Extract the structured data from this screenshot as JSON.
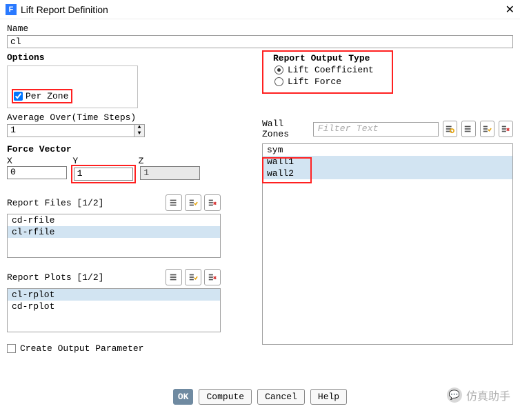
{
  "window": {
    "icon_letter": "F",
    "title": "Lift Report Definition"
  },
  "name_section": {
    "label": "Name",
    "value": "cl"
  },
  "options": {
    "label": "Options",
    "per_zone_label": "Per Zone",
    "per_zone_checked": true
  },
  "avg": {
    "label": "Average Over(Time Steps)",
    "value": "1"
  },
  "force_vector": {
    "label": "Force Vector",
    "x_label": "X",
    "y_label": "Y",
    "z_label": "Z",
    "x": "0",
    "y": "1",
    "z": "1"
  },
  "report_files": {
    "label": "Report Files [1/2]",
    "items": [
      {
        "text": "cd-rfile",
        "selected": false
      },
      {
        "text": "cl-rfile",
        "selected": true
      }
    ]
  },
  "report_plots": {
    "label": "Report Plots [1/2]",
    "items": [
      {
        "text": "cl-rplot",
        "selected": true
      },
      {
        "text": "cd-rplot",
        "selected": false
      }
    ]
  },
  "create_output_param": {
    "label": "Create Output Parameter",
    "checked": false
  },
  "report_output_type": {
    "label": "Report Output Type",
    "options": [
      {
        "text": "Lift Coefficient",
        "selected": true
      },
      {
        "text": "Lift Force",
        "selected": false
      }
    ]
  },
  "wall_zones": {
    "label": "Wall Zones",
    "filter_placeholder": "Filter Text",
    "items": [
      {
        "text": "sym",
        "selected": false
      },
      {
        "text": "wall1",
        "selected": true
      },
      {
        "text": "wall2",
        "selected": true
      }
    ]
  },
  "footer": {
    "ok": "OK",
    "compute": "Compute",
    "cancel": "Cancel",
    "help": "Help"
  },
  "watermark": "仿真助手"
}
